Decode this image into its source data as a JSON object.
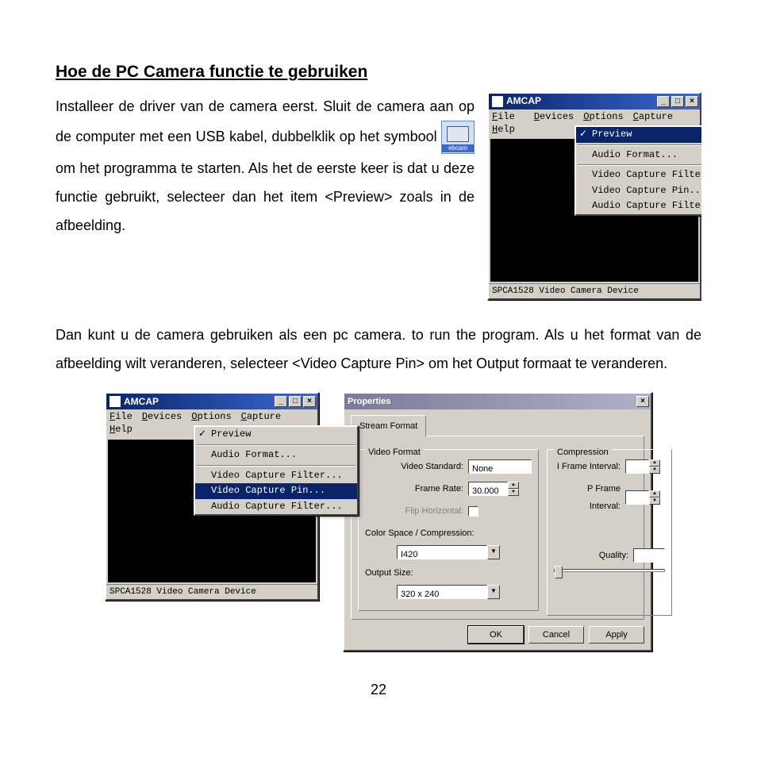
{
  "heading": "Hoe de PC Camera functie te gebruiken",
  "para1_a": "Installeer de driver van de camera eerst. Sluit de camera aan op de computer met een USB kabel, dubbelklik op het symbool ",
  "icon_label": "ebcam",
  "para1_b": " om het programma te starten. Als het de eerste keer is dat u deze functie gebruikt, selecteer dan het item <Preview> zoals in de afbeelding.",
  "para2": "Dan kunt u de camera gebruiken als een pc camera. to run the program. Als u het format van de afbeelding wilt veranderen, selecteer <Video Capture Pin> om het Output formaat te veranderen.",
  "page_number": "22",
  "amcap": {
    "title": "AMCAP",
    "menus": {
      "file": "File",
      "devices": "Devices",
      "options": "Options",
      "capture": "Capture",
      "help": "Help"
    },
    "status": "SPCA1528 Video Camera Device",
    "options_menu": {
      "preview": "Preview",
      "audio_format": "Audio Format...",
      "video_filter": "Video Capture Filter...",
      "video_pin": "Video Capture Pin...",
      "audio_filter": "Audio Capture Filter..."
    }
  },
  "properties": {
    "title": "Properties",
    "tab": "Stream Format",
    "grp_video": "Video Format",
    "grp_comp": "Compression",
    "video_standard_lbl": "Video Standard:",
    "video_standard_val": "None",
    "frame_rate_lbl": "Frame Rate:",
    "frame_rate_val": "30.000",
    "flip_lbl": "Flip Horizontal:",
    "colorspace_lbl": "Color Space / Compression:",
    "colorspace_val": "I420",
    "outputsize_lbl": "Output Size:",
    "outputsize_val": "320 x 240",
    "iframe_lbl": "I Frame Interval:",
    "pframe_lbl": "P Frame Interval:",
    "quality_lbl": "Quality:",
    "ok": "OK",
    "cancel": "Cancel",
    "apply": "Apply"
  }
}
